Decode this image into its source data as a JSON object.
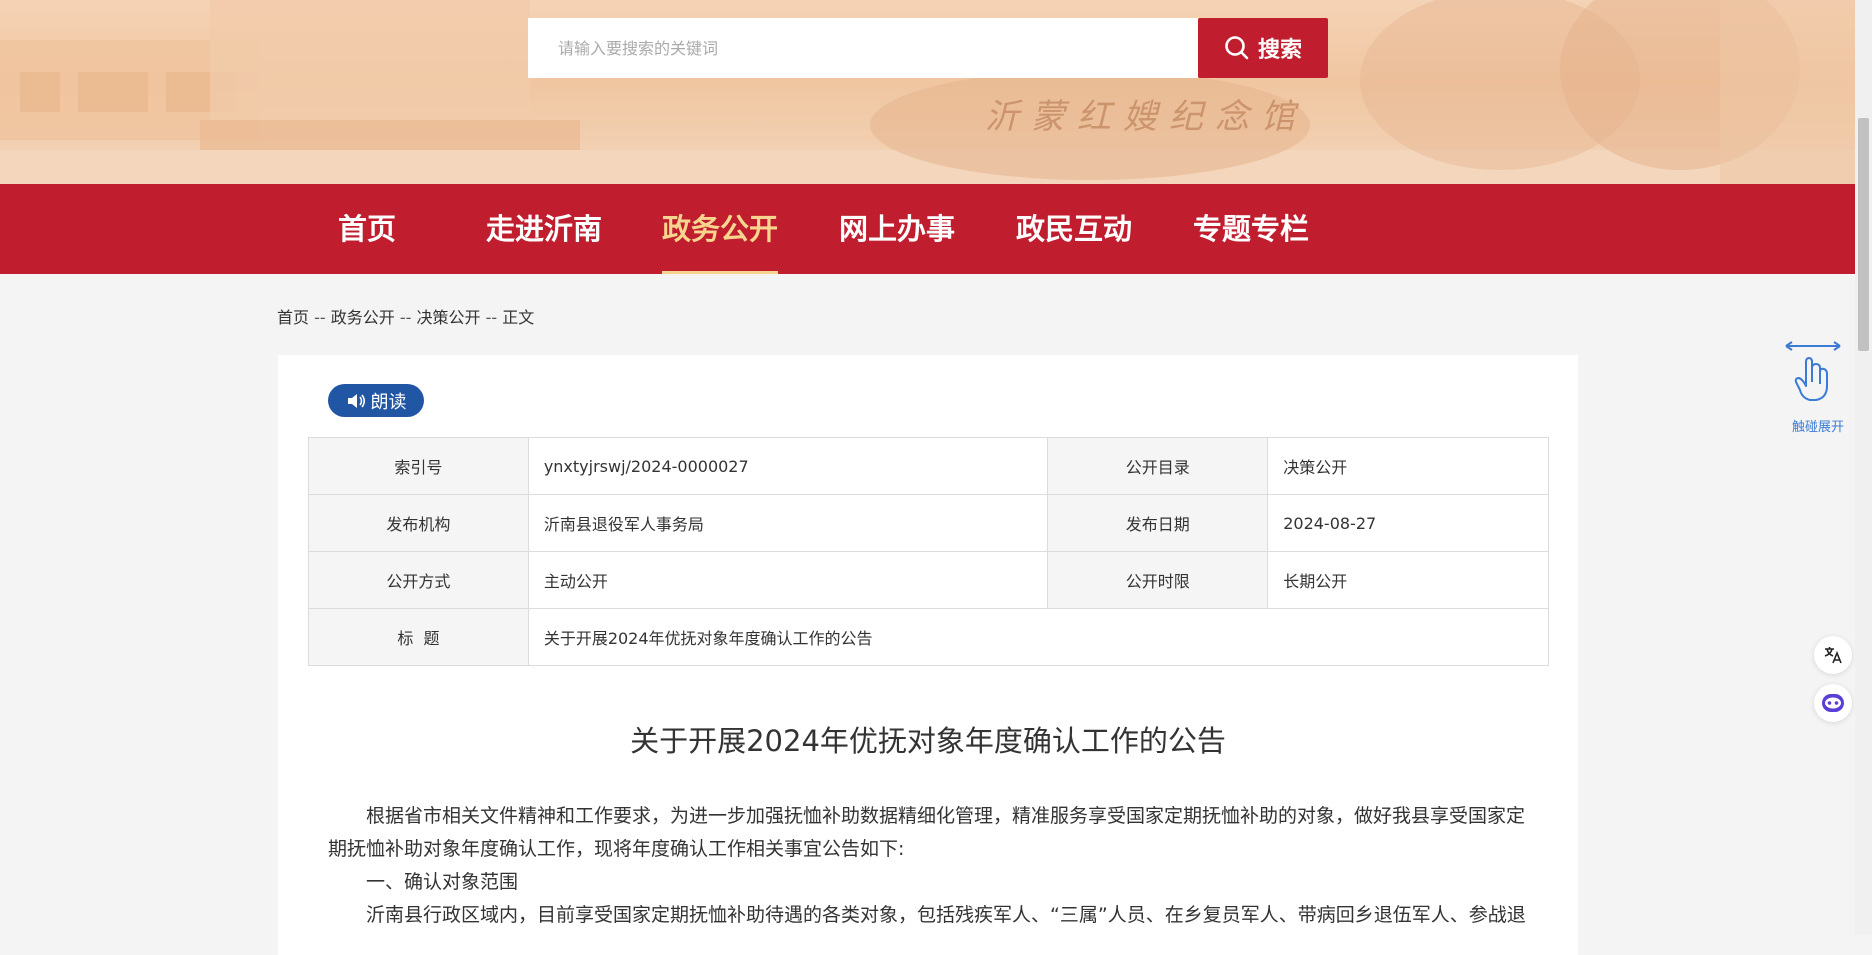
{
  "search": {
    "placeholder": "请输入要搜索的关键词",
    "button_label": "搜索"
  },
  "nav": {
    "items": [
      {
        "label": "首页"
      },
      {
        "label": "走进沂南"
      },
      {
        "label": "政务公开",
        "active": true
      },
      {
        "label": "网上办事"
      },
      {
        "label": "政民互动"
      },
      {
        "label": "专题专栏"
      }
    ]
  },
  "breadcrumb": {
    "items": [
      "首页",
      "政务公开",
      "决策公开",
      "正文"
    ],
    "separator": "--"
  },
  "read_button": {
    "label": "朗读",
    "icon": "speaker-icon"
  },
  "meta_table": {
    "index_no_label": "索引号",
    "index_no_value": "ynxtyjrswj/2024-0000027",
    "catalog_label": "公开目录",
    "catalog_value": "决策公开",
    "publisher_label": "发布机构",
    "publisher_value": "沂南县退役军人事务局",
    "date_label": "发布日期",
    "date_value": "2024-08-27",
    "method_label": "公开方式",
    "method_value": "主动公开",
    "period_label": "公开时限",
    "period_value": "长期公开",
    "title_label": "标  题",
    "title_value": "关于开展2024年优抚对象年度确认工作的公告"
  },
  "article": {
    "title": "关于开展2024年优抚对象年度确认工作的公告",
    "paragraph1": "根据省市相关文件精神和工作要求，为进一步加强抚恤补助数据精细化管理，精准服务享受国家定期抚恤补助的对象，做好我县享受国家定期抚恤补助对象年度确认工作，现将年度确认工作相关事宜公告如下:",
    "section1": "一、确认对象范围",
    "paragraph2": "沂南县行政区域内，目前享受国家定期抚恤补助待遇的各类对象，包括残疾军人、“三属”人员、在乡复员军人、带病回乡退伍军人、参战退"
  },
  "widgets": {
    "touch_expand_label": "触碰展开",
    "translate_icon": "translate-icon",
    "assistant_icon": "robot-assistant-icon"
  },
  "colors": {
    "brand_red": "#c01d2e",
    "nav_active": "#f7d58e",
    "read_button": "#2156a5"
  }
}
